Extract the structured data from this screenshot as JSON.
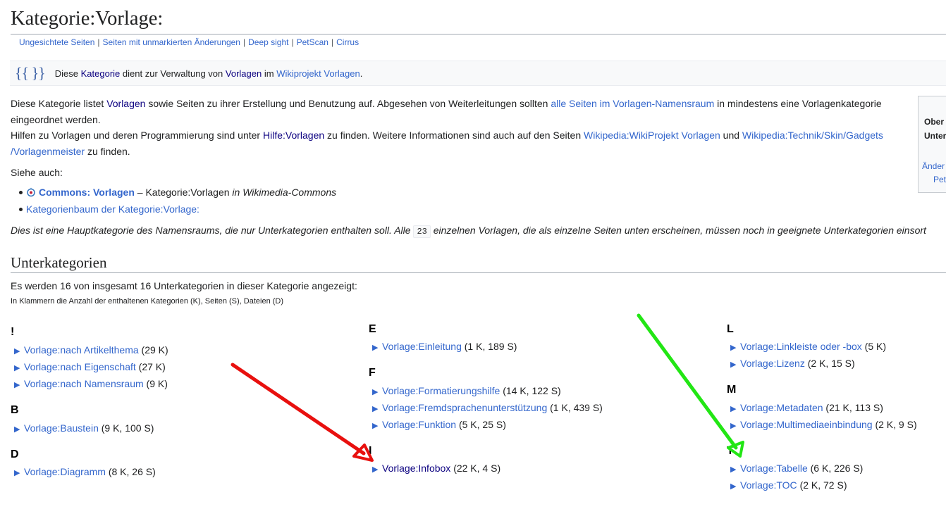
{
  "page": {
    "title": "Kategorie:Vorlage:"
  },
  "toolbar": {
    "links": [
      "Ungesichtete Seiten",
      "Seiten mit unmarkierten Änderungen",
      "Deep sight",
      "PetScan",
      "Cirrus"
    ]
  },
  "notice": {
    "icon": "{{ }}",
    "t1": "Diese",
    "l1": "Kategorie",
    "t2": "dient zur Verwaltung von",
    "l2": "Vorlagen",
    "t3": "im",
    "l3": "Wikiprojekt Vorlagen",
    "t4": "."
  },
  "side_box": {
    "bold1": "Ober",
    "bold2": "Unter",
    "link1": "Änder",
    "link2": "Pet"
  },
  "intro": {
    "p1_a": "Diese Kategorie listet ",
    "p1_link1": "Vorlagen",
    "p1_b": " sowie Seiten zu ihrer Erstellung und Benutzung auf. Abgesehen von Weiterleitungen sollten ",
    "p1_link2": "alle Seiten im Vorlagen-Namensraum",
    "p1_c": " in mindestens eine Vorlagenkategorie eingeordnet werden.",
    "p2_a": "Hilfen zu Vorlagen und deren Programmierung sind unter ",
    "p2_link1": "Hilfe:Vorlagen",
    "p2_b": " zu finden. Weitere Informationen sind auch auf den Seiten ",
    "p2_link2": "Wikipedia:WikiProjekt Vorlagen",
    "p2_c": " und ",
    "p2_link3": "Wikipedia:Technik/Skin/Gadgets /Vorlagenmeister",
    "p2_d": " zu finden."
  },
  "see_also": {
    "label": "Siehe auch:",
    "commons_link": "Commons: Vorlagen",
    "commons_rest": " – Kategorie:Vorlagen ",
    "commons_italic": "in Wikimedia-Commons",
    "tree_link": "Kategorienbaum der Kategorie:Vorlage:"
  },
  "main_note": {
    "a": "Dies ist eine Hauptkategorie des Namensraums, die nur Unterkategorien enthalten soll. Alle ",
    "count": "23",
    "b": " einzelnen Vorlagen, die als einzelne Seiten unten erscheinen, müssen noch in geeignete Unterkategorien einsort"
  },
  "subcategories": {
    "heading": "Unterkategorien",
    "count_text": "Es werden 16 von insgesamt 16 Unterkategorien in dieser Kategorie angezeigt:",
    "legend": "In Klammern die Anzahl der enthaltenen Kategorien (K), Seiten (S), Dateien (D)",
    "columns": [
      {
        "groups": [
          {
            "letter": "!",
            "items": [
              {
                "name": "Vorlage:nach Artikelthema",
                "count": "(29 K)"
              },
              {
                "name": "Vorlage:nach Eigenschaft",
                "count": "(27 K)"
              },
              {
                "name": "Vorlage:nach Namensraum",
                "count": "(9 K)"
              }
            ]
          },
          {
            "letter": "B",
            "items": [
              {
                "name": "Vorlage:Baustein",
                "count": "(9 K, 100 S)"
              }
            ]
          },
          {
            "letter": "D",
            "items": [
              {
                "name": "Vorlage:Diagramm",
                "count": "(8 K, 26 S)"
              }
            ]
          }
        ]
      },
      {
        "groups": [
          {
            "letter": "E",
            "items": [
              {
                "name": "Vorlage:Einleitung",
                "count": "(1 K, 189 S)"
              }
            ]
          },
          {
            "letter": "F",
            "items": [
              {
                "name": "Vorlage:Formatierungshilfe",
                "count": "(14 K, 122 S)"
              },
              {
                "name": "Vorlage:Fremdsprachenunterstützung",
                "count": "(1 K, 439 S)"
              },
              {
                "name": "Vorlage:Funktion",
                "count": "(5 K, 25 S)"
              }
            ]
          },
          {
            "letter": "I",
            "items": [
              {
                "name": "Vorlage:Infobox",
                "count": "(22 K, 4 S)"
              }
            ]
          }
        ]
      },
      {
        "groups": [
          {
            "letter": "L",
            "items": [
              {
                "name": "Vorlage:Linkleiste oder -box",
                "count": "(5 K)"
              },
              {
                "name": "Vorlage:Lizenz",
                "count": "(2 K, 15 S)"
              }
            ]
          },
          {
            "letter": "M",
            "items": [
              {
                "name": "Vorlage:Metadaten",
                "count": "(21 K, 113 S)"
              },
              {
                "name": "Vorlage:Multimediaeinbindung",
                "count": "(2 K, 9 S)"
              }
            ]
          },
          {
            "letter": "T",
            "items": [
              {
                "name": "Vorlage:Tabelle",
                "count": "(6 K, 226 S)"
              },
              {
                "name": "Vorlage:TOC",
                "count": "(2 K, 72 S)"
              }
            ]
          }
        ]
      }
    ]
  },
  "annotations": {
    "red_arrow_color": "#e8100e",
    "green_arrow_color": "#22e614"
  }
}
